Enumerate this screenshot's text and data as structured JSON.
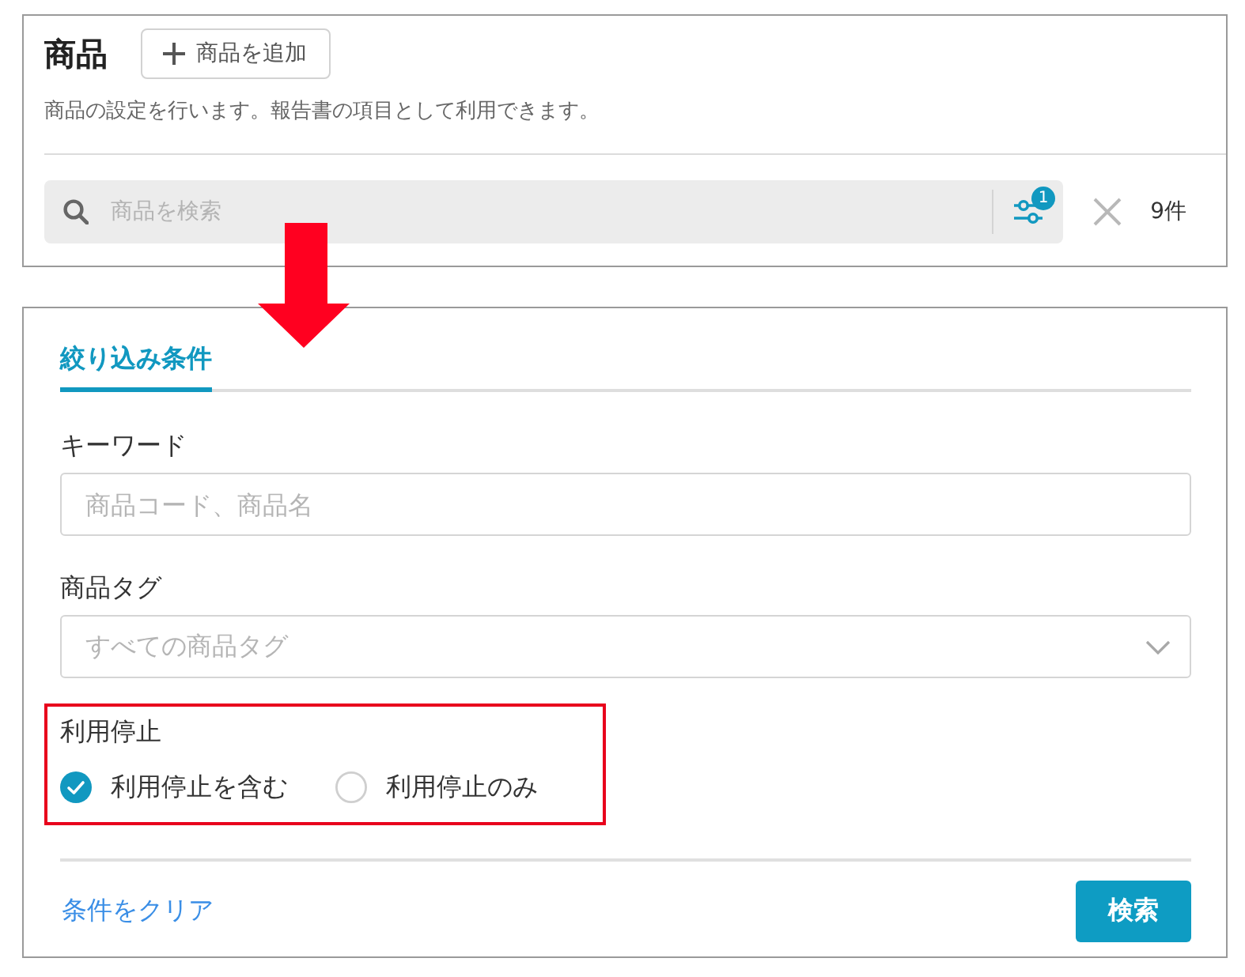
{
  "header": {
    "title": "商品",
    "add_button": {
      "label": "商品を追加"
    },
    "description": "商品の設定を行います。報告書の項目として利用できます。"
  },
  "search": {
    "placeholder": "商品を検索",
    "filter_badge": "1",
    "result_count": "9件"
  },
  "filter_panel": {
    "tabs": [
      {
        "label": "絞り込み条件",
        "selected": true
      }
    ],
    "fields": [
      {
        "kind": "text",
        "label": "キーワード",
        "placeholder": "商品コード、商品名"
      },
      {
        "kind": "select",
        "label": "商品タグ",
        "placeholder": "すべての商品タグ"
      },
      {
        "kind": "radio",
        "label": "利用停止",
        "highlighted": true,
        "options": [
          {
            "label": "利用停止を含む",
            "selected": true
          },
          {
            "label": "利用停止のみ",
            "selected": false
          }
        ]
      }
    ],
    "clear_link": "条件をクリア",
    "search_button": "検索"
  }
}
